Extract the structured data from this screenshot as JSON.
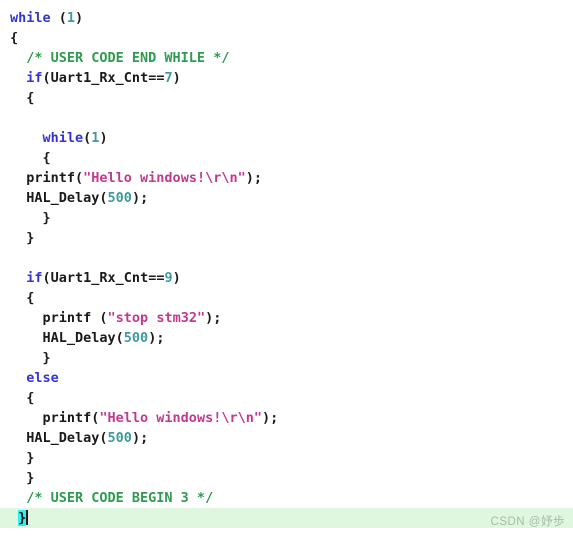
{
  "editor": {
    "language": "c",
    "colors": {
      "background": "#ffffff",
      "keyword": "#3434d4",
      "comment": "#2f9b51",
      "string": "#c2398e",
      "number": "#3d9aa0",
      "plain": "#1a1a1a",
      "current_line_background": "#dff7df",
      "bracket_match_background": "#2ff0f0"
    },
    "lines": [
      {
        "id": "line-1",
        "highlight": false,
        "tokens": [
          {
            "t": "kw",
            "s": "while"
          },
          {
            "t": "plain",
            "s": " ("
          },
          {
            "t": "num",
            "s": "1"
          },
          {
            "t": "plain",
            "s": ")"
          }
        ]
      },
      {
        "id": "line-2",
        "highlight": false,
        "tokens": [
          {
            "t": "plain",
            "s": "{"
          }
        ]
      },
      {
        "id": "line-3",
        "highlight": false,
        "tokens": [
          {
            "t": "cmt",
            "s": "  /* USER CODE END WHILE */"
          }
        ]
      },
      {
        "id": "line-4",
        "highlight": false,
        "tokens": [
          {
            "t": "plain",
            "s": "  "
          },
          {
            "t": "kw",
            "s": "if"
          },
          {
            "t": "plain",
            "s": "(Uart1_Rx_Cnt=="
          },
          {
            "t": "num",
            "s": "7"
          },
          {
            "t": "plain",
            "s": ")"
          }
        ]
      },
      {
        "id": "line-5",
        "highlight": false,
        "tokens": [
          {
            "t": "plain",
            "s": "  {"
          }
        ]
      },
      {
        "id": "line-6",
        "highlight": false,
        "tokens": [
          {
            "t": "plain",
            "s": ""
          }
        ]
      },
      {
        "id": "line-7",
        "highlight": false,
        "tokens": [
          {
            "t": "plain",
            "s": "    "
          },
          {
            "t": "kw",
            "s": "while"
          },
          {
            "t": "plain",
            "s": "("
          },
          {
            "t": "num",
            "s": "1"
          },
          {
            "t": "plain",
            "s": ")"
          }
        ]
      },
      {
        "id": "line-8",
        "highlight": false,
        "tokens": [
          {
            "t": "plain",
            "s": "    {"
          }
        ]
      },
      {
        "id": "line-9",
        "highlight": false,
        "tokens": [
          {
            "t": "plain",
            "s": "  printf("
          },
          {
            "t": "str",
            "s": "\"Hello windows!\\r\\n\""
          },
          {
            "t": "plain",
            "s": ");"
          }
        ]
      },
      {
        "id": "line-10",
        "highlight": false,
        "tokens": [
          {
            "t": "plain",
            "s": "  HAL_Delay("
          },
          {
            "t": "num",
            "s": "500"
          },
          {
            "t": "plain",
            "s": ");"
          }
        ]
      },
      {
        "id": "line-11",
        "highlight": false,
        "tokens": [
          {
            "t": "plain",
            "s": "    }"
          }
        ]
      },
      {
        "id": "line-12",
        "highlight": false,
        "tokens": [
          {
            "t": "plain",
            "s": "  }"
          }
        ]
      },
      {
        "id": "line-13",
        "highlight": false,
        "tokens": [
          {
            "t": "plain",
            "s": ""
          }
        ]
      },
      {
        "id": "line-14",
        "highlight": false,
        "tokens": [
          {
            "t": "plain",
            "s": "  "
          },
          {
            "t": "kw",
            "s": "if"
          },
          {
            "t": "plain",
            "s": "(Uart1_Rx_Cnt=="
          },
          {
            "t": "num",
            "s": "9"
          },
          {
            "t": "plain",
            "s": ")"
          }
        ]
      },
      {
        "id": "line-15",
        "highlight": false,
        "tokens": [
          {
            "t": "plain",
            "s": "  {"
          }
        ]
      },
      {
        "id": "line-16",
        "highlight": false,
        "tokens": [
          {
            "t": "plain",
            "s": "    printf ("
          },
          {
            "t": "str",
            "s": "\"stop stm32\""
          },
          {
            "t": "plain",
            "s": ");"
          }
        ]
      },
      {
        "id": "line-17",
        "highlight": false,
        "tokens": [
          {
            "t": "plain",
            "s": "    HAL_Delay("
          },
          {
            "t": "num",
            "s": "500"
          },
          {
            "t": "plain",
            "s": ");"
          }
        ]
      },
      {
        "id": "line-18",
        "highlight": false,
        "tokens": [
          {
            "t": "plain",
            "s": "    }"
          }
        ]
      },
      {
        "id": "line-19",
        "highlight": false,
        "tokens": [
          {
            "t": "plain",
            "s": "  "
          },
          {
            "t": "kw",
            "s": "else"
          }
        ]
      },
      {
        "id": "line-20",
        "highlight": false,
        "tokens": [
          {
            "t": "plain",
            "s": "  {"
          }
        ]
      },
      {
        "id": "line-21",
        "highlight": false,
        "tokens": [
          {
            "t": "plain",
            "s": "    printf("
          },
          {
            "t": "str",
            "s": "\"Hello windows!\\r\\n\""
          },
          {
            "t": "plain",
            "s": ");"
          }
        ]
      },
      {
        "id": "line-22",
        "highlight": false,
        "tokens": [
          {
            "t": "plain",
            "s": "  HAL_Delay("
          },
          {
            "t": "num",
            "s": "500"
          },
          {
            "t": "plain",
            "s": ");"
          }
        ]
      },
      {
        "id": "line-23",
        "highlight": false,
        "tokens": [
          {
            "t": "plain",
            "s": "  }"
          }
        ]
      },
      {
        "id": "line-24",
        "highlight": false,
        "tokens": [
          {
            "t": "plain",
            "s": "  }"
          }
        ]
      },
      {
        "id": "line-25",
        "highlight": false,
        "tokens": [
          {
            "t": "cmt",
            "s": "  /* USER CODE BEGIN 3 */"
          }
        ]
      },
      {
        "id": "line-26",
        "highlight": true,
        "tokens": [
          {
            "t": "plain",
            "s": " "
          },
          {
            "t": "bracket-match",
            "s": "}"
          },
          {
            "t": "caret",
            "s": ""
          }
        ]
      }
    ]
  },
  "watermark": {
    "text": "CSDN @妤歩"
  }
}
